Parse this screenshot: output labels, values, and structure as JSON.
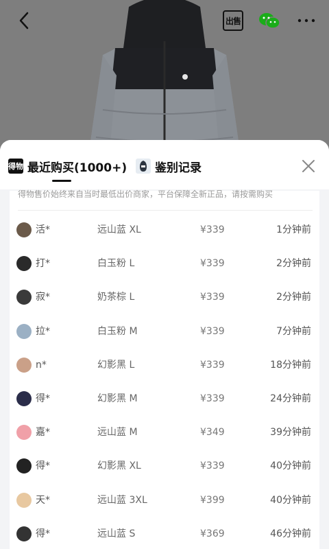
{
  "header": {
    "back_icon": "chevron-left-icon",
    "sell_label": "出售",
    "wechat_icon": "wechat-icon",
    "more_icon": "more-icon"
  },
  "tabs": [
    {
      "logo": "得物",
      "label": "最近购买(1000+)",
      "active": true
    },
    {
      "label": "鉴别记录",
      "active": false
    }
  ],
  "notice": "得物售价始终来自当时最低出价商家，平台保障全新正品，请按需购买",
  "rows": [
    {
      "name": "活*",
      "spec": "远山蓝 XL",
      "price": "¥339",
      "time": "1分钟前"
    },
    {
      "name": "打*",
      "spec": "白玉粉 L",
      "price": "¥339",
      "time": "2分钟前"
    },
    {
      "name": "寂*",
      "spec": "奶茶棕 L",
      "price": "¥339",
      "time": "2分钟前"
    },
    {
      "name": "拉*",
      "spec": "白玉粉 M",
      "price": "¥339",
      "time": "7分钟前"
    },
    {
      "name": "n*",
      "spec": "幻影黑 L",
      "price": "¥339",
      "time": "18分钟前"
    },
    {
      "name": "得*",
      "spec": "幻影黑 M",
      "price": "¥339",
      "time": "24分钟前"
    },
    {
      "name": "嘉*",
      "spec": "远山蓝 M",
      "price": "¥349",
      "time": "39分钟前"
    },
    {
      "name": "得*",
      "spec": "幻影黑 XL",
      "price": "¥339",
      "time": "40分钟前"
    },
    {
      "name": "天*",
      "spec": "远山蓝 3XL",
      "price": "¥399",
      "time": "40分钟前"
    },
    {
      "name": "得*",
      "spec": "远山蓝 S",
      "price": "¥369",
      "time": "46分钟前"
    }
  ],
  "colors": {
    "wechat": "#1aad19",
    "sheet_bg": "#f3f4f6"
  }
}
